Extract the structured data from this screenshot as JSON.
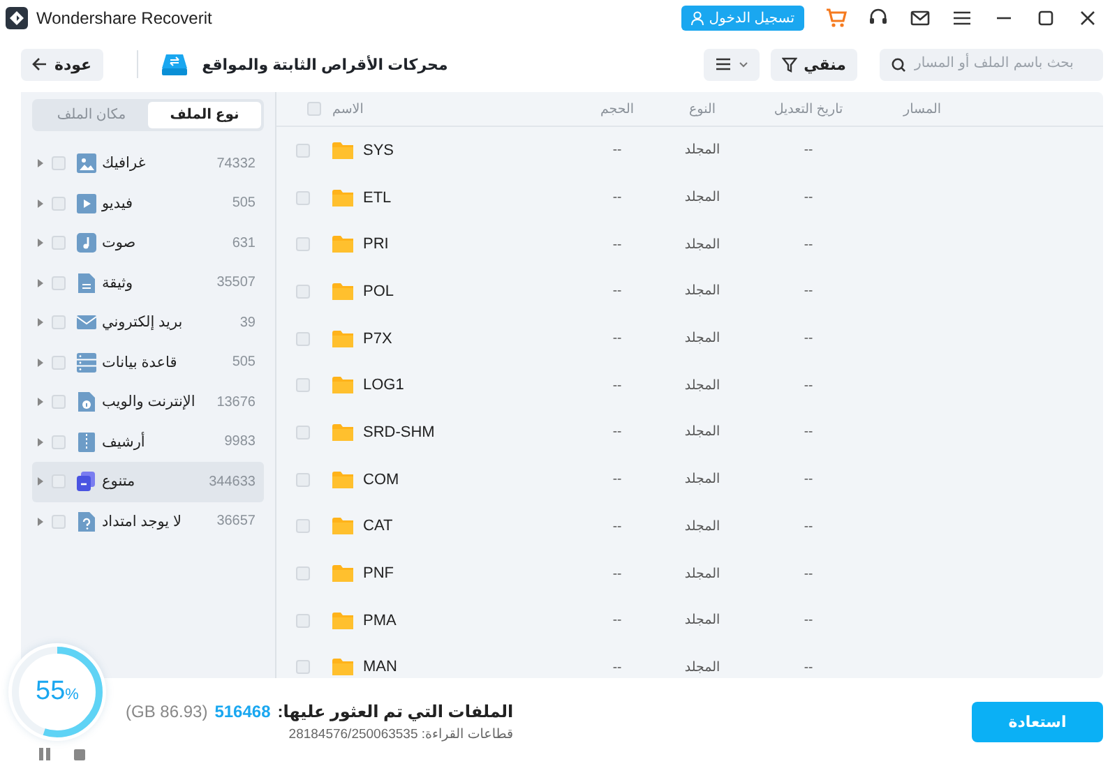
{
  "window": {
    "title": "Wondershare Recoverit",
    "login_button": "تسجيل الدخول"
  },
  "toolbar": {
    "back_button": "عودة",
    "location_title": "محركات الأقراص الثابتة والمواقع",
    "filter_button": "منقي",
    "search": {
      "placeholder": "بحث باسم الملف أو المسار"
    }
  },
  "sidebar": {
    "tabs": [
      {
        "label": "نوع الملف",
        "selected": true
      },
      {
        "label": "مكان الملف",
        "selected": false
      }
    ],
    "items": [
      {
        "label": "غرافيك",
        "count": "74332",
        "checked": false,
        "selected": false
      },
      {
        "label": "فيديو",
        "count": "505",
        "checked": false,
        "selected": false
      },
      {
        "label": "صوت",
        "count": "631",
        "checked": false,
        "selected": false
      },
      {
        "label": "وثيقة",
        "count": "35507",
        "checked": false,
        "selected": false
      },
      {
        "label": "بريد إلكتروني",
        "count": "39",
        "checked": false,
        "selected": false
      },
      {
        "label": "قاعدة بيانات",
        "count": "505",
        "checked": false,
        "selected": false
      },
      {
        "label": "الإنترنت والويب",
        "count": "13676",
        "checked": false,
        "selected": false
      },
      {
        "label": "أرشيف",
        "count": "9983",
        "checked": false,
        "selected": false
      },
      {
        "label": "متنوع",
        "count": "344633",
        "checked": false,
        "selected": true
      },
      {
        "label": "لا يوجد امتداد",
        "count": "36657",
        "checked": false,
        "selected": false
      }
    ]
  },
  "table": {
    "select_all_checked": false,
    "columns": [
      "المسار",
      "تاريخ التعديل",
      "النوع",
      "الحجم",
      "الاسم"
    ],
    "rows": [
      {
        "name": "SYS",
        "size": "--",
        "type": "المجلد",
        "modified": "--",
        "checked": false
      },
      {
        "name": "ETL",
        "size": "--",
        "type": "المجلد",
        "modified": "--",
        "checked": false
      },
      {
        "name": "PRI",
        "size": "--",
        "type": "المجلد",
        "modified": "--",
        "checked": false
      },
      {
        "name": "POL",
        "size": "--",
        "type": "المجلد",
        "modified": "--",
        "checked": false
      },
      {
        "name": "P7X",
        "size": "--",
        "type": "المجلد",
        "modified": "--",
        "checked": false
      },
      {
        "name": "LOG1",
        "size": "--",
        "type": "المجلد",
        "modified": "--",
        "checked": false
      },
      {
        "name": "SRD-SHM",
        "size": "--",
        "type": "المجلد",
        "modified": "--",
        "checked": false
      },
      {
        "name": "COM",
        "size": "--",
        "type": "المجلد",
        "modified": "--",
        "checked": false
      },
      {
        "name": "CAT",
        "size": "--",
        "type": "المجلد",
        "modified": "--",
        "checked": false
      },
      {
        "name": "PNF",
        "size": "--",
        "type": "المجلد",
        "modified": "--",
        "checked": false
      },
      {
        "name": "PMA",
        "size": "--",
        "type": "المجلد",
        "modified": "--",
        "checked": false
      },
      {
        "name": "MAN",
        "size": "--",
        "type": "المجلد",
        "modified": "--",
        "checked": false
      }
    ]
  },
  "status": {
    "progress": {
      "percent": "55",
      "unit": "%",
      "level": 0.55
    },
    "found_label": "الملفات التي تم العثور عليها:",
    "found_count": "516468",
    "found_size": "(GB 86.93)",
    "sectors": "قطاعات القراءة: 28184576/250063535",
    "recover_button": "استعادة"
  }
}
